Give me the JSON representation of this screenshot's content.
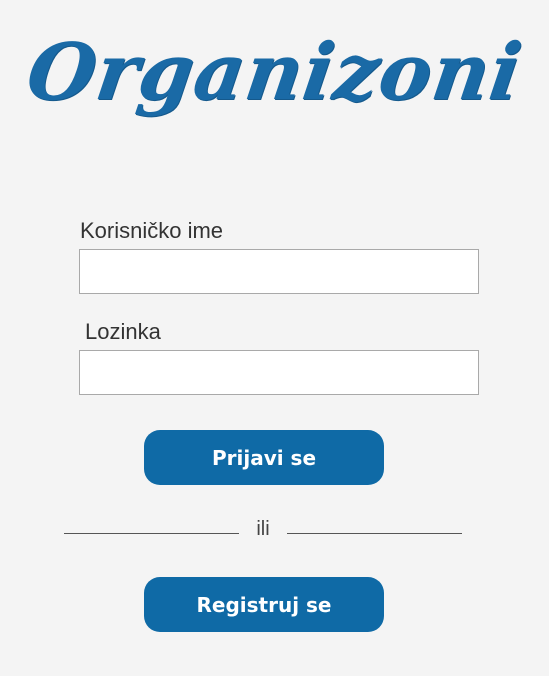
{
  "app": {
    "logo_text": "Organizoni"
  },
  "login_form": {
    "username_label": "Korisničko ime",
    "username_value": "",
    "password_label": "Lozinka",
    "password_value": "",
    "login_button": "Prijavi se"
  },
  "divider": {
    "text": "ili"
  },
  "register": {
    "button": "Registruj se"
  },
  "colors": {
    "brand_blue": "#1a6aa6",
    "button_blue": "#0f6aa6",
    "background": "#f4f4f4"
  }
}
